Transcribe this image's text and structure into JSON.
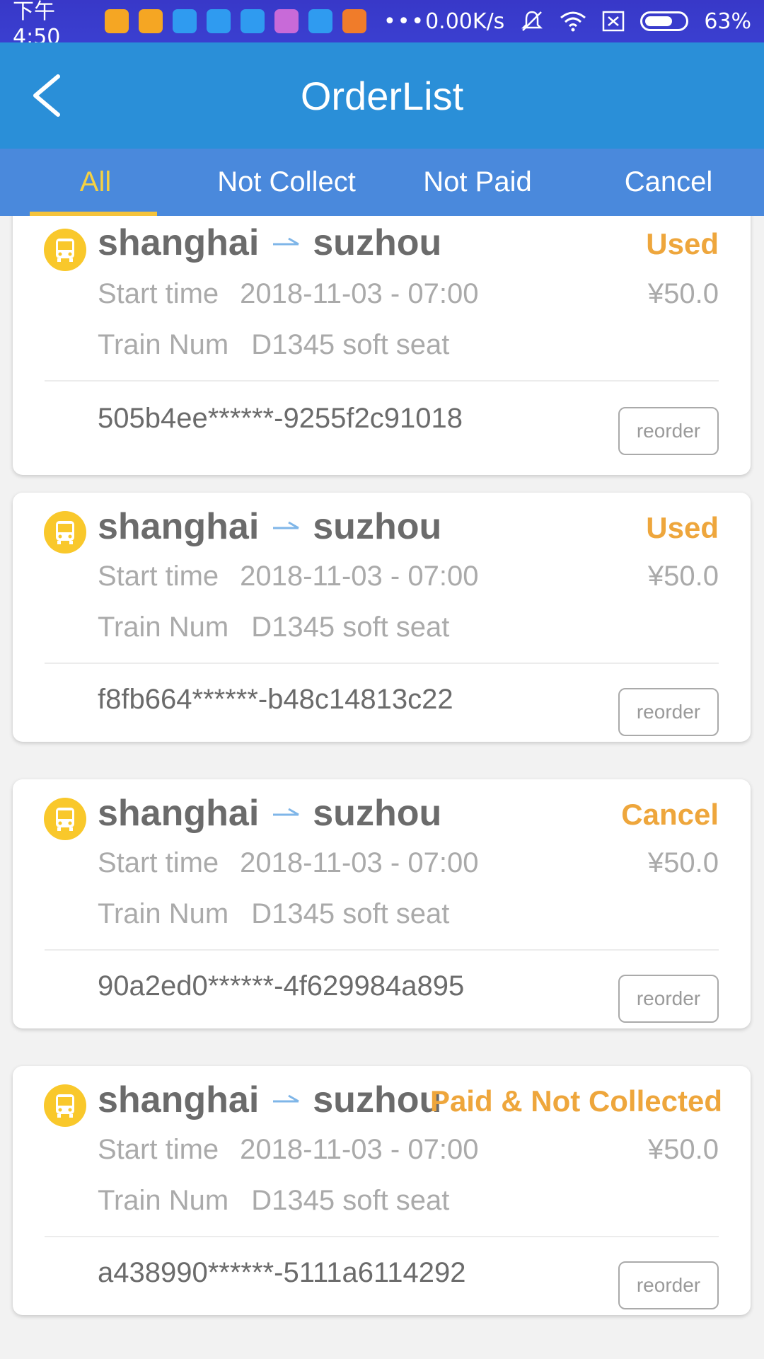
{
  "statusbar": {
    "time": "下午4:50",
    "network_speed": "0.00K/s",
    "battery_percent": "63%",
    "app_icon_colors": [
      "#f5a623",
      "#f5a623",
      "#2f9bf0",
      "#2f9bf0",
      "#2f9bf0",
      "#c86ad8",
      "#2f9bf0",
      "#f07c2a"
    ]
  },
  "appbar": {
    "title": "OrderList",
    "back_icon": "chevron-left-icon"
  },
  "tabs": [
    {
      "label": "All",
      "active": true
    },
    {
      "label": "Not Collect",
      "active": false
    },
    {
      "label": "Not Paid",
      "active": false
    },
    {
      "label": "Cancel",
      "active": false
    }
  ],
  "orders": [
    {
      "from": "shanghai",
      "to": "suzhou",
      "status": "Used",
      "start_label": "Start time",
      "start_time": "2018-11-03 - 07:00",
      "price": "¥50.0",
      "train_label": "Train Num",
      "train": "D1345 soft seat",
      "order_id": "505b4ee******-9255f2c91018",
      "button": "reorder"
    },
    {
      "from": "shanghai",
      "to": "suzhou",
      "status": "Used",
      "start_label": "Start time",
      "start_time": "2018-11-03 - 07:00",
      "price": "¥50.0",
      "train_label": "Train Num",
      "train": "D1345 soft seat",
      "order_id": "f8fb664******-b48c14813c22",
      "button": "reorder"
    },
    {
      "from": "shanghai",
      "to": "suzhou",
      "status": "Cancel",
      "start_label": "Start time",
      "start_time": "2018-11-03 - 07:00",
      "price": "¥50.0",
      "train_label": "Train Num",
      "train": "D1345 soft seat",
      "order_id": "90a2ed0******-4f629984a895",
      "button": "reorder"
    },
    {
      "from": "shanghai",
      "to": "suzhou",
      "status": "Paid & Not Collected",
      "start_label": "Start time",
      "start_time": "2018-11-03 - 07:00",
      "price": "¥50.0",
      "train_label": "Train Num",
      "train": "D1345 soft seat",
      "order_id": "a438990******-5111a6114292",
      "button": "reorder"
    }
  ],
  "colors": {
    "appbar": "#2a8fd8",
    "tabs": "#4a89dc",
    "active_tab": "#f5d142",
    "status": "#eea63c",
    "bus_icon": "#f9c82b"
  }
}
